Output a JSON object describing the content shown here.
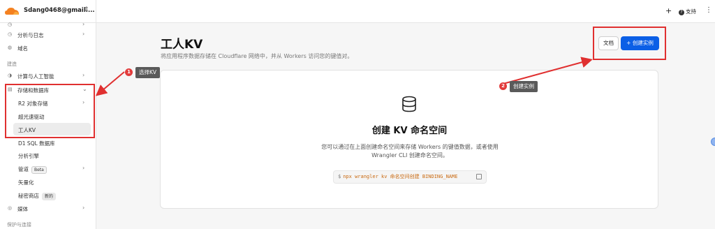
{
  "topbar": {
    "account": "Sdang0468@gmail....",
    "help_label": "支持"
  },
  "sidebar": {
    "items": [
      {
        "label": "分析与日志"
      },
      {
        "label": "域名"
      },
      {
        "label": "计算与人工智能"
      },
      {
        "label": "存储和数据库"
      },
      {
        "label": "R2 对象存储"
      },
      {
        "label": "超光速驱动"
      },
      {
        "label": "工人KV"
      },
      {
        "label": "D1 SQL 数据库"
      },
      {
        "label": "分析引擎"
      },
      {
        "label": "管道",
        "badge": "Beta"
      },
      {
        "label": "矢量化"
      },
      {
        "label": "秘密商店",
        "badge": "新的"
      },
      {
        "label": "媒体"
      }
    ],
    "section_build": "建造",
    "section_protect": "保护与连接"
  },
  "main": {
    "title": "工人KV",
    "subtitle": "将应用程序数据存储在 Cloudflare 网络中，并从 Workers 访问您的键值对。",
    "doc_button": "文档",
    "create_button": "+ 创建实例",
    "empty_title": "创建 KV 命名空间",
    "empty_desc": "您可以通过在上面创建命名空间来存储 Workers 的键值数据，或者使用 Wrangler CLI 创建命名空间。",
    "code_prompt": "$",
    "code": "npx wrangler kv 命名空间创建 BINDING_NAME"
  },
  "annotations": {
    "marker1": "1",
    "tip1": "选择KV",
    "marker2": "2",
    "tip2": "创建实例",
    "color": "#e03030"
  }
}
